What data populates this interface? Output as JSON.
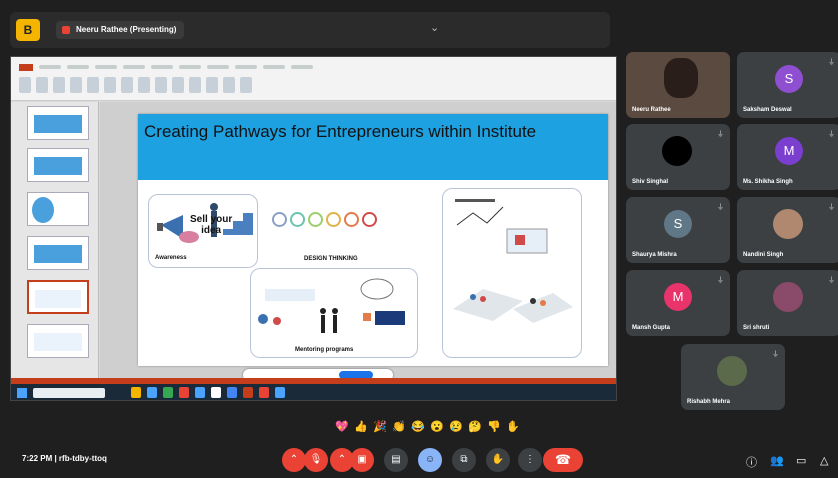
{
  "topbar": {
    "app_badge": "B",
    "presenting_label": "Neeru Rathee (Presenting)",
    "collapse_icon": "chevron-down-icon"
  },
  "slide": {
    "title": "Creating Pathways for Entrepreneurs within Institute",
    "awareness": "Awareness",
    "design_thinking": "DESIGN THINKING",
    "sell_line1": "Sell your",
    "sell_line2": "idea",
    "mentoring": "Mentoring programs"
  },
  "participants": [
    {
      "name": "Neeru Rathee",
      "initial": "",
      "color": "#6b5a4e"
    },
    {
      "name": "Saksham Deswal",
      "initial": "S",
      "color": "#8e4fd0"
    },
    {
      "name": "Shiv Singhal",
      "initial": "",
      "color": "#111111"
    },
    {
      "name": "Ms. Shikha Singh",
      "initial": "M",
      "color": "#7b3fd0"
    },
    {
      "name": "Shaurya Mishra",
      "initial": "S",
      "color": "#5f7787"
    },
    {
      "name": "Nandini Singh",
      "initial": "",
      "color": "#8a6a5a"
    },
    {
      "name": "Mansh Gupta",
      "initial": "M",
      "color": "#e8336b"
    },
    {
      "name": "Sri shruti",
      "initial": "",
      "color": "#7a3a5a"
    },
    {
      "name": "Rishabh Mehra",
      "initial": "",
      "color": "#4a5a3a"
    }
  ],
  "reactions": [
    "💖",
    "👍",
    "🎉",
    "👏",
    "😂",
    "😮",
    "😢",
    "🤔",
    "👎",
    "✋"
  ],
  "bottom": {
    "clock": "7:22 PM  |  rfb-tdby-ttoq",
    "mic_icon": "mic-icon",
    "camera_icon": "camera-icon",
    "leave_icon": "call-end-icon"
  },
  "colors": {
    "background": "#1f1f1f",
    "tile": "#3c4043",
    "slide_header": "#1da1e0",
    "leave": "#ea4335",
    "accent": "#8ab4f8"
  }
}
